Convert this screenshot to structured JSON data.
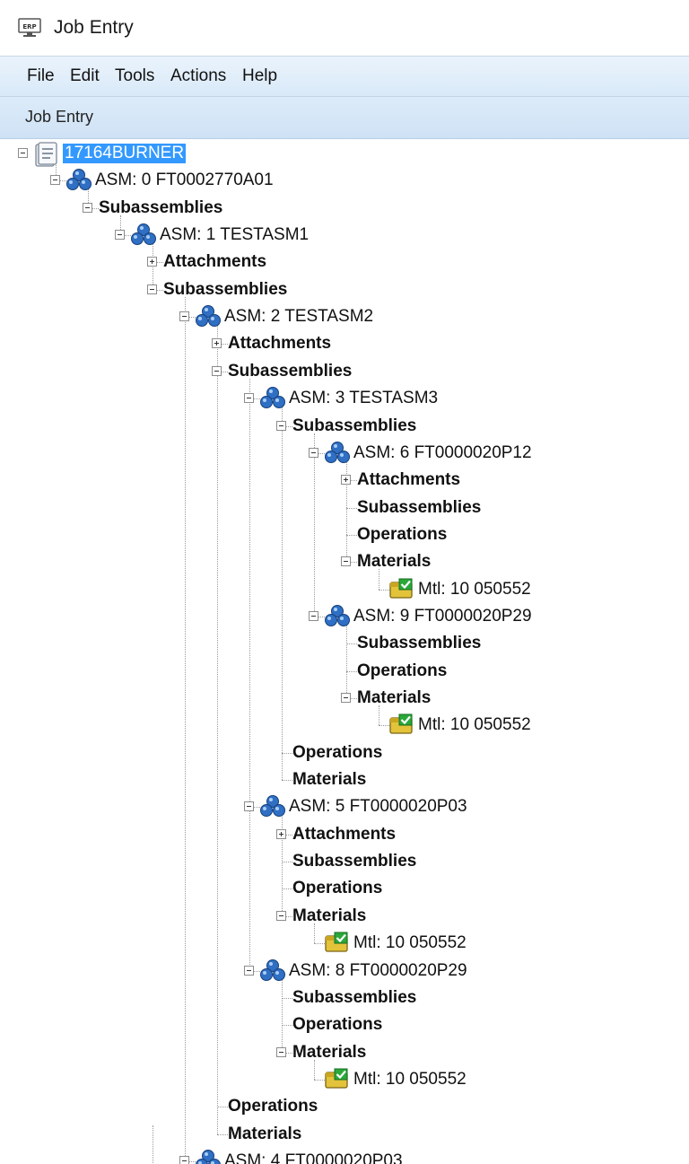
{
  "window": {
    "title": "Job Entry",
    "app_icon_text": "ERP"
  },
  "menubar": {
    "items": [
      "File",
      "Edit",
      "Tools",
      "Actions",
      "Help"
    ]
  },
  "form": {
    "title": "Job Entry"
  },
  "tree": {
    "nodes": [
      {
        "id": "n0",
        "label": "17164BURNER",
        "level": 0,
        "icon": "job-folder-icon",
        "expander": "minus",
        "bold": false,
        "selected": true
      },
      {
        "id": "n1",
        "label": "ASM: 0 FT0002770A01",
        "level": 1,
        "icon": "assembly-icon",
        "expander": "minus",
        "bold": false
      },
      {
        "id": "n2",
        "label": "Subassemblies",
        "level": 2,
        "icon": null,
        "expander": "minus",
        "bold": true
      },
      {
        "id": "n3",
        "label": "ASM: 1 TESTASM1",
        "level": 3,
        "icon": "assembly-icon",
        "expander": "minus",
        "bold": false
      },
      {
        "id": "n4",
        "label": "Attachments",
        "level": 4,
        "icon": null,
        "expander": "plus",
        "bold": true
      },
      {
        "id": "n5",
        "label": "Subassemblies",
        "level": 4,
        "icon": null,
        "expander": "minus",
        "bold": true
      },
      {
        "id": "n6",
        "label": "ASM: 2 TESTASM2",
        "level": 5,
        "icon": "assembly-icon",
        "expander": "minus",
        "bold": false
      },
      {
        "id": "n7",
        "label": "Attachments",
        "level": 6,
        "icon": null,
        "expander": "plus",
        "bold": true
      },
      {
        "id": "n8",
        "label": "Subassemblies",
        "level": 6,
        "icon": null,
        "expander": "minus",
        "bold": true
      },
      {
        "id": "n9",
        "label": "ASM: 3 TESTASM3",
        "level": 7,
        "icon": "assembly-icon",
        "expander": "minus",
        "bold": false
      },
      {
        "id": "n10",
        "label": "Subassemblies",
        "level": 8,
        "icon": null,
        "expander": "minus",
        "bold": true
      },
      {
        "id": "n11",
        "label": "ASM: 6 FT0000020P12",
        "level": 9,
        "icon": "assembly-icon",
        "expander": "minus",
        "bold": false
      },
      {
        "id": "n12",
        "label": "Attachments",
        "level": 10,
        "icon": null,
        "expander": "plus",
        "bold": true
      },
      {
        "id": "n13",
        "label": "Subassemblies",
        "level": 10,
        "icon": null,
        "expander": null,
        "bold": true
      },
      {
        "id": "n14",
        "label": "Operations",
        "level": 10,
        "icon": null,
        "expander": null,
        "bold": true
      },
      {
        "id": "n15",
        "label": "Materials",
        "level": 10,
        "icon": null,
        "expander": "minus",
        "bold": true
      },
      {
        "id": "n16",
        "label": "Mtl: 10 050552",
        "level": 11,
        "icon": "material-icon",
        "expander": null,
        "bold": false
      },
      {
        "id": "n17",
        "label": "ASM: 9 FT0000020P29",
        "level": 9,
        "icon": "assembly-icon",
        "expander": "minus",
        "bold": false
      },
      {
        "id": "n18",
        "label": "Subassemblies",
        "level": 10,
        "icon": null,
        "expander": null,
        "bold": true
      },
      {
        "id": "n19",
        "label": "Operations",
        "level": 10,
        "icon": null,
        "expander": null,
        "bold": true
      },
      {
        "id": "n20",
        "label": "Materials",
        "level": 10,
        "icon": null,
        "expander": "minus",
        "bold": true
      },
      {
        "id": "n21",
        "label": "Mtl: 10 050552",
        "level": 11,
        "icon": "material-icon",
        "expander": null,
        "bold": false
      },
      {
        "id": "n22",
        "label": "Operations",
        "level": 8,
        "icon": null,
        "expander": null,
        "bold": true
      },
      {
        "id": "n23",
        "label": "Materials",
        "level": 8,
        "icon": null,
        "expander": null,
        "bold": true
      },
      {
        "id": "n24",
        "label": "ASM: 5 FT0000020P03",
        "level": 7,
        "icon": "assembly-icon",
        "expander": "minus",
        "bold": false
      },
      {
        "id": "n25",
        "label": "Attachments",
        "level": 8,
        "icon": null,
        "expander": "plus",
        "bold": true
      },
      {
        "id": "n26",
        "label": "Subassemblies",
        "level": 8,
        "icon": null,
        "expander": null,
        "bold": true
      },
      {
        "id": "n27",
        "label": "Operations",
        "level": 8,
        "icon": null,
        "expander": null,
        "bold": true
      },
      {
        "id": "n28",
        "label": "Materials",
        "level": 8,
        "icon": null,
        "expander": "minus",
        "bold": true
      },
      {
        "id": "n29",
        "label": "Mtl: 10 050552",
        "level": 9,
        "icon": "material-icon",
        "expander": null,
        "bold": false
      },
      {
        "id": "n30",
        "label": "ASM: 8 FT0000020P29",
        "level": 7,
        "icon": "assembly-icon",
        "expander": "minus",
        "bold": false
      },
      {
        "id": "n31",
        "label": "Subassemblies",
        "level": 8,
        "icon": null,
        "expander": null,
        "bold": true
      },
      {
        "id": "n32",
        "label": "Operations",
        "level": 8,
        "icon": null,
        "expander": null,
        "bold": true
      },
      {
        "id": "n33",
        "label": "Materials",
        "level": 8,
        "icon": null,
        "expander": "minus",
        "bold": true
      },
      {
        "id": "n34",
        "label": "Mtl: 10 050552",
        "level": 9,
        "icon": "material-icon",
        "expander": null,
        "bold": false
      },
      {
        "id": "n35",
        "label": "Operations",
        "level": 6,
        "icon": null,
        "expander": null,
        "bold": true
      },
      {
        "id": "n36",
        "label": "Materials",
        "level": 6,
        "icon": null,
        "expander": null,
        "bold": true
      },
      {
        "id": "n37",
        "label": "ASM: 4 FT0000020P03",
        "level": 5,
        "icon": "assembly-icon",
        "expander": "minus",
        "bold": false
      }
    ]
  }
}
